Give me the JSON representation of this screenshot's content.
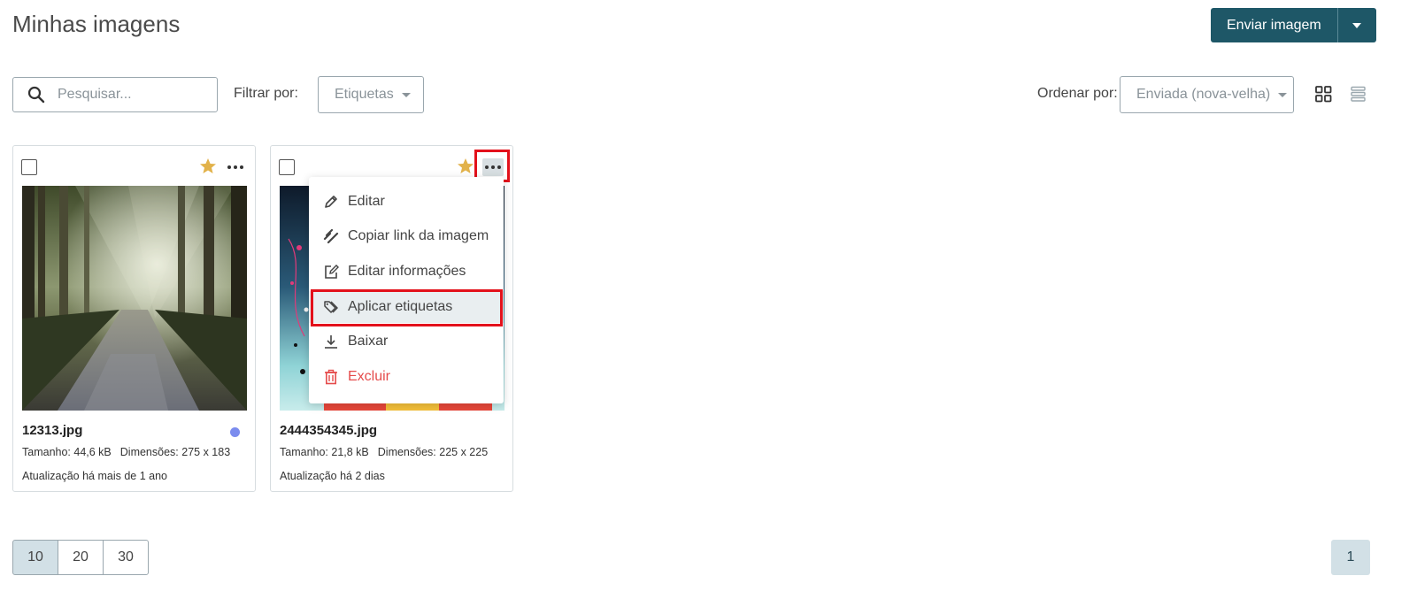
{
  "header": {
    "title": "Minhas imagens",
    "upload_label": "Enviar imagem"
  },
  "toolbar": {
    "search_placeholder": "Pesquisar...",
    "filter_label": "Filtrar por:",
    "filter_value": "Etiquetas",
    "sort_label": "Ordenar por:",
    "sort_value": "Enviada (nova-velha)"
  },
  "cards": [
    {
      "filename": "12313.jpg",
      "size": "Tamanho: 44,6 kB",
      "dimensions": "Dimensões: 275 x 183",
      "updated": "Atualização há mais de 1 ano",
      "starred": true,
      "dot_color": "#7b8cee"
    },
    {
      "filename": "2444354345.jpg",
      "size": "Tamanho: 21,8 kB",
      "dimensions": "Dimensões: 225 x 225",
      "updated": "Atualização há 2 dias",
      "starred": true
    }
  ],
  "context_menu": {
    "items": [
      {
        "label": "Editar",
        "icon": "pencil-icon"
      },
      {
        "label": "Copiar link da imagem",
        "icon": "link-icon"
      },
      {
        "label": "Editar informações",
        "icon": "edit-info-icon"
      },
      {
        "label": "Aplicar etiquetas",
        "icon": "tags-icon"
      },
      {
        "label": "Baixar",
        "icon": "download-icon"
      },
      {
        "label": "Excluir",
        "icon": "trash-icon"
      }
    ]
  },
  "pagination": {
    "page_sizes": [
      "10",
      "20",
      "30"
    ],
    "active_page_size": "10",
    "current_page": "1"
  },
  "colors": {
    "primary": "#1e5767",
    "star": "#e2b24a",
    "danger": "#e54b4b",
    "annotation": "#e3111b"
  }
}
